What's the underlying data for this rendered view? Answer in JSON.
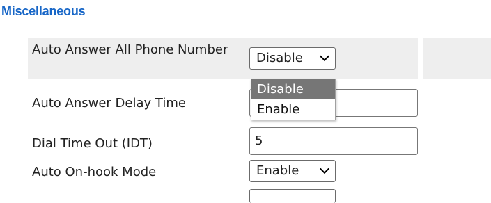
{
  "section": {
    "title": "Miscellaneous"
  },
  "rows": [
    {
      "label": "Auto Answer All Phone Number",
      "value": "Disable"
    },
    {
      "label": "Auto Answer Delay Time",
      "value": ""
    },
    {
      "label": "Dial Time Out (IDT)",
      "value": "5"
    },
    {
      "label": "Auto On-hook Mode",
      "value": "Enable"
    }
  ],
  "dropdown": {
    "options": [
      {
        "label": "Disable",
        "selected": true
      },
      {
        "label": "Enable",
        "selected": false
      }
    ]
  },
  "colors": {
    "section_title": "#1766c7",
    "row_highlight": "#eeeeee",
    "option_selected_bg": "#767676"
  }
}
